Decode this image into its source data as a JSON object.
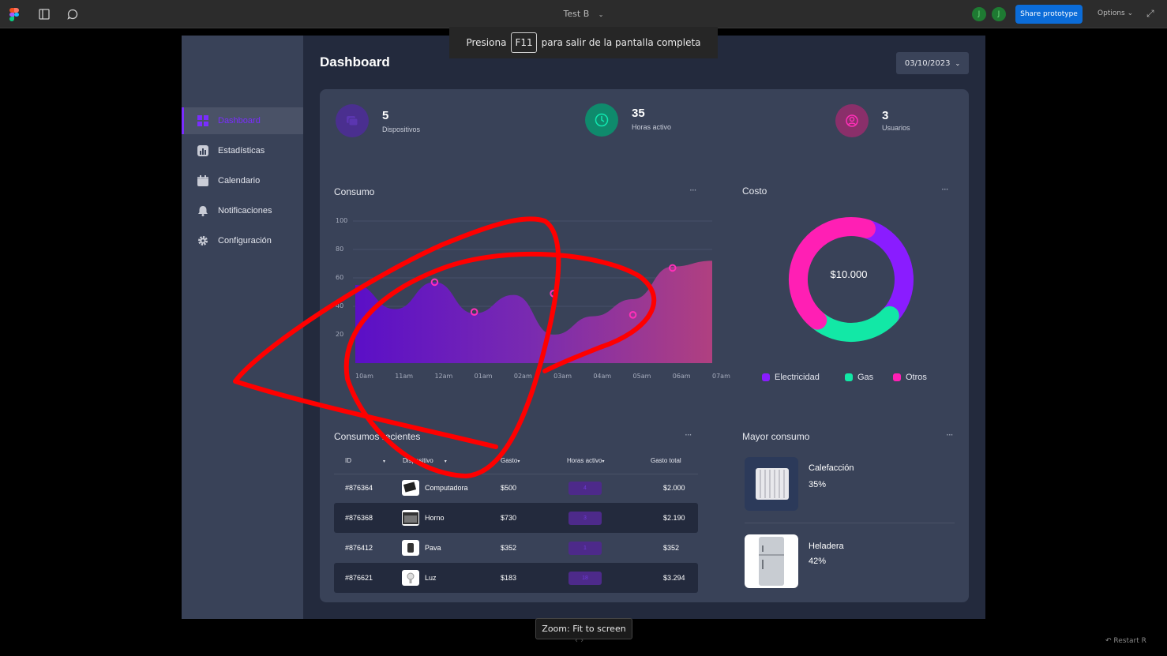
{
  "toolbar": {
    "doc_title": "Test B",
    "share_label": "Share prototype",
    "options_label": "Options",
    "avatars": [
      "J",
      "J"
    ]
  },
  "toast": {
    "before": "Presiona",
    "key": "F11",
    "after": "para salir de la pantalla completa"
  },
  "page": {
    "title": "Dashboard",
    "date": "03/10/2023"
  },
  "sidebar": {
    "items": [
      {
        "label": "Dashboard",
        "icon": "grid-icon"
      },
      {
        "label": "Estadísticas",
        "icon": "bar-chart-icon"
      },
      {
        "label": "Calendario",
        "icon": "calendar-icon"
      },
      {
        "label": "Notificaciones",
        "icon": "bell-icon"
      },
      {
        "label": "Configuración",
        "icon": "gear-icon"
      }
    ]
  },
  "stats": [
    {
      "value": "5",
      "label": "Dispositivos",
      "icon": "devices-icon",
      "color": "#4a2f8f"
    },
    {
      "value": "35",
      "label": "Horas activo",
      "icon": "clock-icon",
      "color": "#0f8a6c"
    },
    {
      "value": "3",
      "label": "Usuarios",
      "icon": "user-icon",
      "color": "#8a2f6a"
    }
  ],
  "consumo": {
    "title": "Consumo",
    "more": "···"
  },
  "costo": {
    "title": "Costo",
    "more": "···",
    "center": "$10.000",
    "legend": [
      {
        "label": "Electricidad",
        "color": "#8a1cff"
      },
      {
        "label": "Gas",
        "color": "#12e8a6"
      },
      {
        "label": "Otros",
        "color": "#ff1fb4"
      }
    ]
  },
  "chart_data": [
    {
      "type": "area",
      "x": [
        "10am",
        "11am",
        "12am",
        "01am",
        "02am",
        "03am",
        "04am",
        "05am",
        "06am",
        "07am"
      ],
      "yticks": [
        100,
        80,
        60,
        40,
        20
      ],
      "ylim": [
        0,
        100
      ],
      "series": [
        {
          "values": [
            55,
            38,
            57,
            35,
            48,
            20,
            33,
            45,
            68,
            72
          ]
        }
      ],
      "markers": [
        {
          "x": "12am",
          "y": 57
        },
        {
          "x": "01am",
          "y": 36
        },
        {
          "x": "03am",
          "y": 49
        },
        {
          "x": "05am",
          "y": 34
        },
        {
          "x": "06am",
          "y": 67
        }
      ]
    },
    {
      "type": "pie",
      "categories": [
        "Electricidad",
        "Gas",
        "Otros"
      ],
      "values": [
        32,
        24,
        44
      ]
    }
  ],
  "recientes": {
    "title": "Consumos recientes",
    "more": "···",
    "headers": [
      "ID",
      "Dispositivo",
      "Gasto",
      "Horas activo",
      "Gasto total"
    ],
    "rows": [
      {
        "id": "#876364",
        "device": "Computadora",
        "gasto": "$500",
        "horas": "4",
        "total": "$2.000"
      },
      {
        "id": "#876368",
        "device": "Horno",
        "gasto": "$730",
        "horas": "3",
        "total": "$2.190"
      },
      {
        "id": "#876412",
        "device": "Pava",
        "gasto": "$352",
        "horas": "1",
        "total": "$352"
      },
      {
        "id": "#876621",
        "device": "Luz",
        "gasto": "$183",
        "horas": "18",
        "total": "$3.294"
      }
    ]
  },
  "mayor": {
    "title": "Mayor consumo",
    "more": "···",
    "items": [
      {
        "name": "Calefacción",
        "pct": "35%"
      },
      {
        "name": "Heladera",
        "pct": "42%"
      }
    ]
  },
  "footer": {
    "zoom_tip": "Zoom: Fit to screen",
    "restart": "Restart"
  },
  "annotation": {
    "color": "#ff0000"
  }
}
